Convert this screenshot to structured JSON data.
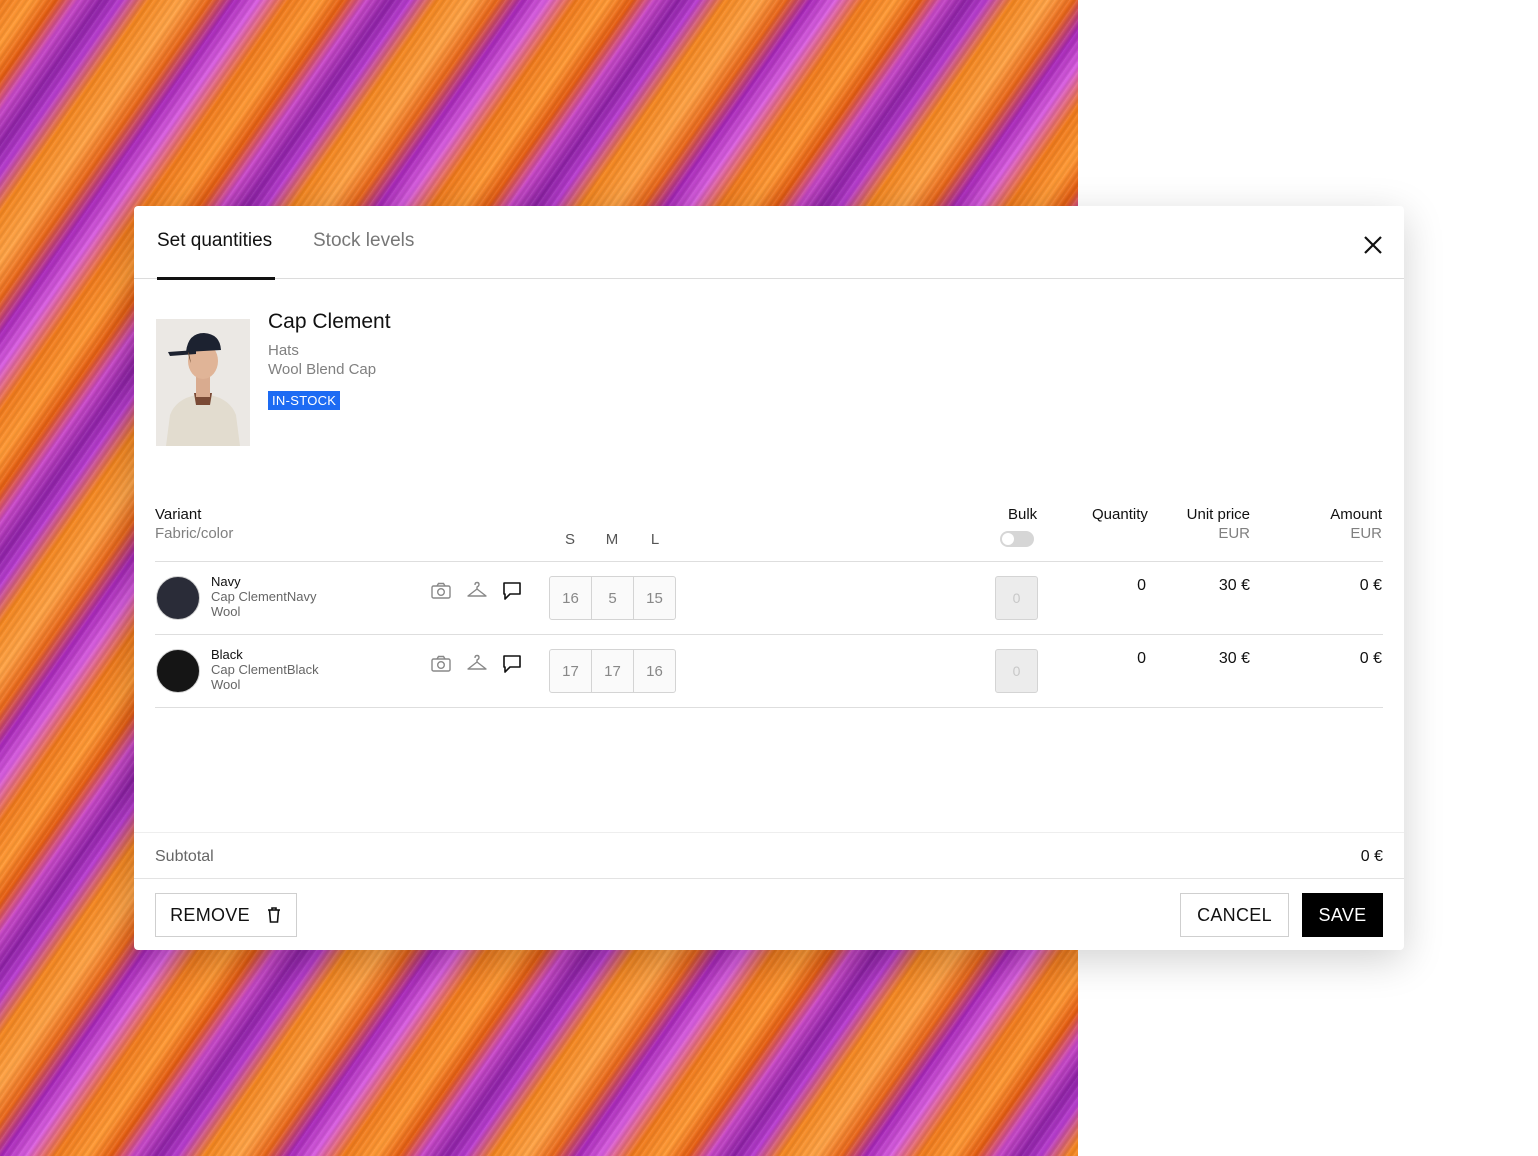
{
  "tabs": [
    {
      "label": "Set quantities",
      "active": true
    },
    {
      "label": "Stock levels",
      "active": false
    }
  ],
  "product": {
    "name": "Cap Clement",
    "category": "Hats",
    "description": "Wool Blend Cap",
    "status_badge": "IN-STOCK",
    "badge_color": "#1d6bf3"
  },
  "table": {
    "headers": {
      "variant": "Variant",
      "variant_sub": "Fabric/color",
      "sizes": [
        "S",
        "M",
        "L"
      ],
      "bulk": "Bulk",
      "quantity": "Quantity",
      "unit_price": "Unit price",
      "unit_price_sub": "EUR",
      "amount": "Amount",
      "amount_sub": "EUR"
    },
    "rows": [
      {
        "color_name": "Navy",
        "variant_name": "Cap ClementNavy",
        "fabric": "Wool",
        "swatch_color": "#2a2c38",
        "sizes": [
          "16",
          "5",
          "15"
        ],
        "bulk": "0",
        "quantity": "0",
        "unit_price": "30 €",
        "amount": "0 €"
      },
      {
        "color_name": "Black",
        "variant_name": "Cap ClementBlack",
        "fabric": "Wool",
        "swatch_color": "#151515",
        "sizes": [
          "17",
          "17",
          "16"
        ],
        "bulk": "0",
        "quantity": "0",
        "unit_price": "30 €",
        "amount": "0 €"
      }
    ]
  },
  "subtotal": {
    "label": "Subtotal",
    "value": "0 €"
  },
  "footer": {
    "remove": "REMOVE",
    "cancel": "CANCEL",
    "save": "SAVE"
  },
  "icons": {
    "close": "close-icon",
    "photo": "camera-icon",
    "hanger": "hanger-icon",
    "comment": "comment-icon",
    "trash": "trash-icon"
  }
}
